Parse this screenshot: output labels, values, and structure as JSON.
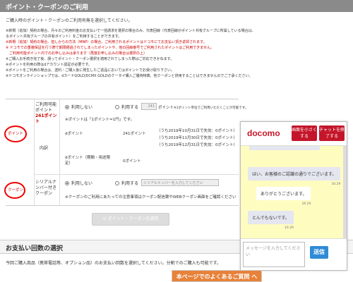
{
  "section_title": "ポイント・クーポンのご利用",
  "intro": "ご購入時のポイント・クーポンのご利用有無を選択してください。",
  "notes": [
    {
      "text": "※新規（追加）契約の場合、月々のご利用料金のお支払いで一括請求を選択の場合のみ、代表回線（代表回線がポイント共有グループに所属している場合は、所属する",
      "red": false
    },
    {
      "text": "るポイント共有グループの共有ポイント）をご利用することができます。",
      "red": false
    },
    {
      "text": "※新規（追加）契約の場合、但しからの方法（MNP）の場合、ご利用されるポイントはドコモにてお支払い頂き返却されます。",
      "red": true
    },
    {
      "text": "※ ドコモでの重複保証を行う際で期限経過されてしまったポイントや、他の回線番号でご利用されたポイントはご利用できません。",
      "red": true
    },
    {
      "text": "　ご利用可能ポイント内でのお申し込みは承ります（再度お申し込みの場合は選択の上）",
      "red": true
    },
    {
      "text": "※ご購入お手続き完了後、誤ってポイント・クーポン選択を適用されてしまった際はご対応できかねます。",
      "red": false
    },
    {
      "text": "※ポイントを利用の際はdアカウント認証が必要です。",
      "red": false
    },
    {
      "text": "※ポイントをご利用の場合は、送料・ご購入後に発生したご返品においてはポイントでお受け取り下さい。",
      "red": false
    },
    {
      "text": "※ドコモオンラインショップでは、dカードGOLD/DCMX GOLDのケータイ購入ご優待特典、他クーポンと併用することはできませんのでご了承ください。",
      "red": false
    }
  ],
  "points": {
    "available_label": "ご利用可能ポイント",
    "available_value": "241ポイント",
    "opt_no": "利用しない",
    "opt_yes": "利用する",
    "input_value": "241",
    "unit": "ポイント",
    "hint_right": "※1ポイント単位でご利用いただくことが可能です。",
    "hint_below": "※ポイントは「1ポイント=1円」です。",
    "detail_label": "内訳",
    "rows": [
      {
        "name": "dポイント",
        "value": "241ポイント",
        "expiry": "（うち2019年10月31日で失効：0ポイント）"
      },
      {
        "name": "",
        "value": "",
        "expiry": "（うち2019年11月30日で失効：0ポイント）"
      },
      {
        "name": "",
        "value": "",
        "expiry": "（うち2019年12月31日で失効：0ポイント）"
      },
      {
        "name": "dポイント（期間・用途限定）",
        "value": "0ポイント",
        "expiry": ""
      }
    ]
  },
  "coupon": {
    "label": "シリアルナンバー付きクーポン",
    "opt_no": "利用しない",
    "opt_yes": "利用する",
    "placeholder": "シリアルナンバーを入力してください",
    "note": "※クーポンのご利用にあたっての注意事項はクーポン配信票やWEBクーポン画面をご確認ください"
  },
  "apply_button": "ポイント・クーポンを適用",
  "section2_title": "お支払い回数の選択",
  "section2_text": "今回ご購入商品（携帯電話等、オプション品）のお支払い回数を選択してください。分割でのご購入も可能です。",
  "faq_button": "本ページでのよくあるご質問 へ",
  "chat": {
    "logo": "docomo",
    "zoom_btn": "画面を小さくする",
    "end_btn": "チャットを終了する",
    "messages": [
      {
        "text": "はい、お客様のご認識の通りでございます。",
        "time": "16:29",
        "side": "left"
      },
      {
        "text": "ありがとうございます。",
        "time": "16:29",
        "side": "right"
      },
      {
        "text": "とんでもないです。",
        "time": "16:29",
        "side": "left"
      }
    ],
    "input_placeholder": "メッセージを入力してください",
    "send": "送信"
  },
  "annotations": [
    "ポイント",
    "クーポン"
  ],
  "colors": {
    "accent_red": "#c4162a",
    "faq_orange": "#e8813a",
    "send_blue": "#2f8bd6",
    "chat_bg": "#fffcc0"
  }
}
